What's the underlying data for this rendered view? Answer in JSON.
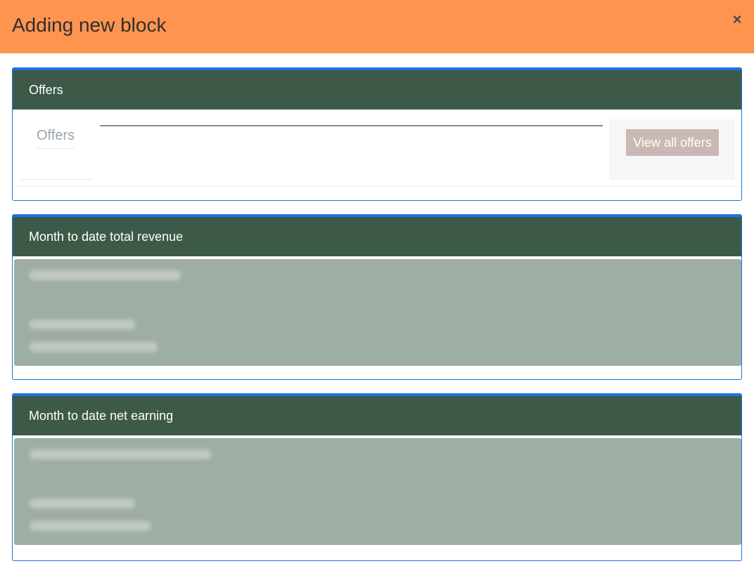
{
  "modal": {
    "title": "Adding new block",
    "close_symbol": "×"
  },
  "blocks": {
    "offers": {
      "title": "Offers",
      "tab_label": "Offers",
      "view_all_label": "View all offers"
    },
    "revenue": {
      "title": "Month to date total revenue"
    },
    "earning": {
      "title": "Month to date net earning"
    }
  },
  "colors": {
    "header_bg": "#ff944f",
    "block_header_bg": "#3d5a48",
    "block_border": "#1a73e8",
    "stat_panel_bg": "#9eaea3",
    "view_all_bg": "#c9b8b3"
  }
}
